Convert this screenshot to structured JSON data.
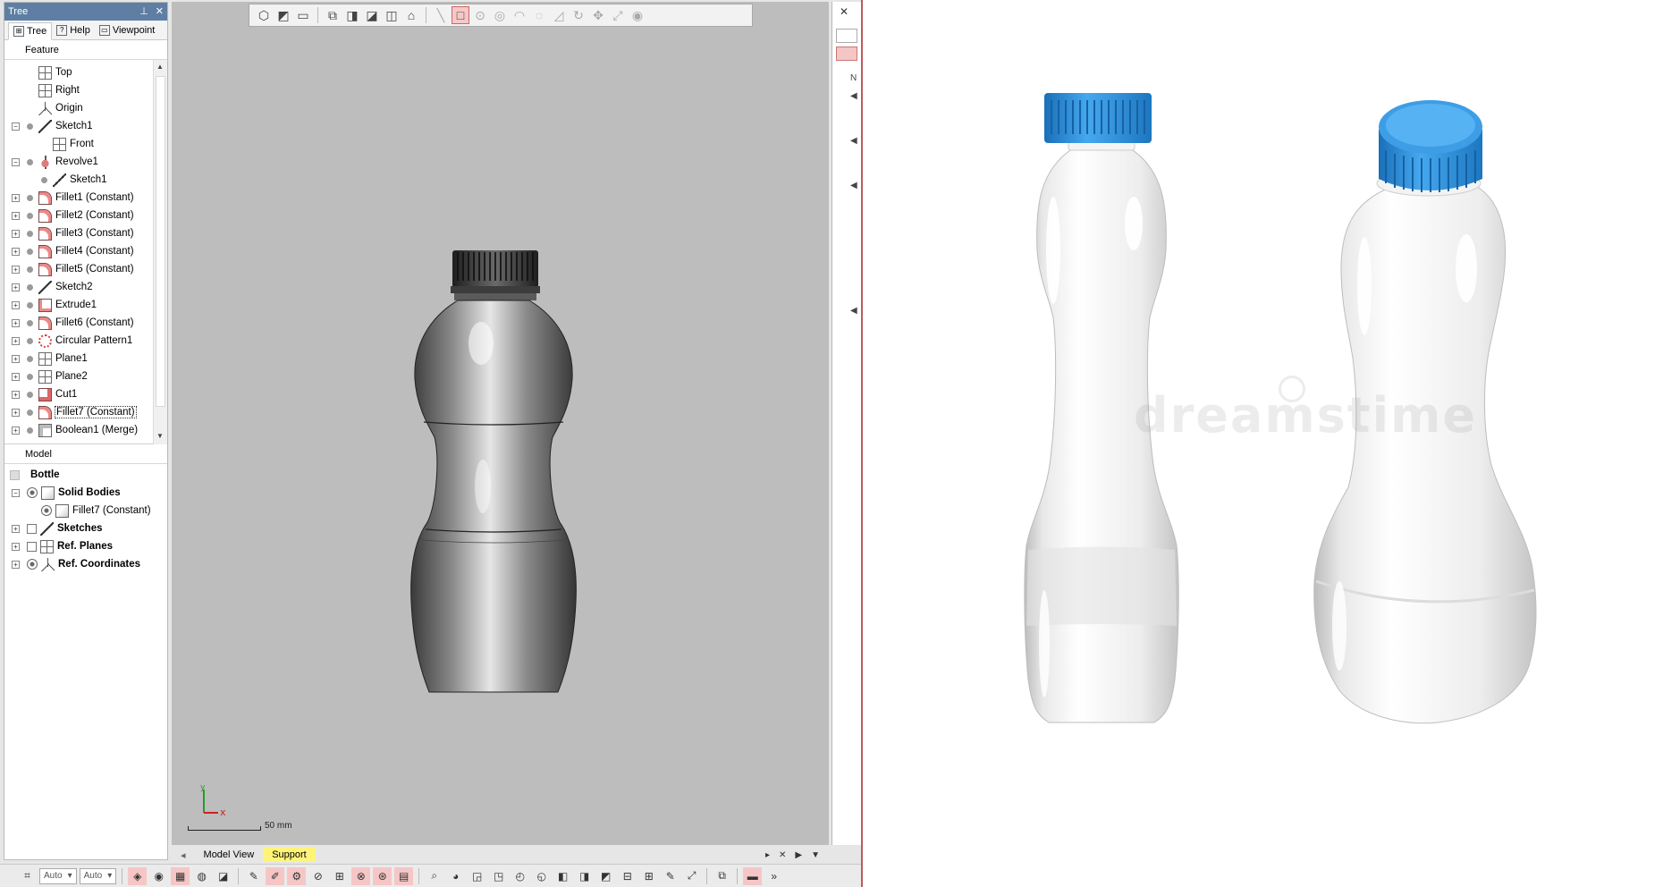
{
  "tree_panel": {
    "title": "Tree",
    "pin": "📌",
    "close": "✕",
    "tabs": [
      "Tree",
      "Help",
      "Viewpoint"
    ],
    "feature_header": "Feature",
    "model_header": "Model"
  },
  "features": [
    {
      "label": "Top",
      "icon": "plane-icon",
      "expander": "",
      "dot": false,
      "indent": 0
    },
    {
      "label": "Right",
      "icon": "plane-icon",
      "expander": "",
      "dot": false,
      "indent": 0
    },
    {
      "label": "Origin",
      "icon": "origin-icon",
      "expander": "",
      "dot": false,
      "indent": 0
    },
    {
      "label": "Sketch1",
      "icon": "sketch-icon",
      "expander": "−",
      "dot": true,
      "indent": 0
    },
    {
      "label": "Front",
      "icon": "plane-icon",
      "expander": "",
      "dot": false,
      "indent": 1
    },
    {
      "label": "Revolve1",
      "icon": "revolve-icon",
      "expander": "−",
      "dot": true,
      "indent": 0
    },
    {
      "label": "Sketch1",
      "icon": "sketch-icon",
      "expander": "",
      "dot": true,
      "indent": 1
    },
    {
      "label": "Fillet1 (Constant)",
      "icon": "fillet-icon",
      "expander": "+",
      "dot": true,
      "indent": 0
    },
    {
      "label": "Fillet2 (Constant)",
      "icon": "fillet-icon",
      "expander": "+",
      "dot": true,
      "indent": 0
    },
    {
      "label": "Fillet3 (Constant)",
      "icon": "fillet-icon",
      "expander": "+",
      "dot": true,
      "indent": 0
    },
    {
      "label": "Fillet4 (Constant)",
      "icon": "fillet-icon",
      "expander": "+",
      "dot": true,
      "indent": 0
    },
    {
      "label": "Fillet5 (Constant)",
      "icon": "fillet-icon",
      "expander": "+",
      "dot": true,
      "indent": 0
    },
    {
      "label": "Sketch2",
      "icon": "sketch-icon",
      "expander": "+",
      "dot": true,
      "indent": 0
    },
    {
      "label": "Extrude1",
      "icon": "extrude-icon",
      "expander": "+",
      "dot": true,
      "indent": 0
    },
    {
      "label": "Fillet6 (Constant)",
      "icon": "fillet-icon",
      "expander": "+",
      "dot": true,
      "indent": 0
    },
    {
      "label": "Circular Pattern1",
      "icon": "pattern-icon",
      "expander": "+",
      "dot": true,
      "indent": 0
    },
    {
      "label": "Plane1",
      "icon": "plane-icon",
      "expander": "+",
      "dot": true,
      "indent": 0
    },
    {
      "label": "Plane2",
      "icon": "plane-icon",
      "expander": "+",
      "dot": true,
      "indent": 0
    },
    {
      "label": "Cut1",
      "icon": "cut-icon",
      "expander": "+",
      "dot": true,
      "indent": 0
    },
    {
      "label": "Fillet7 (Constant)",
      "icon": "fillet-icon",
      "expander": "+",
      "dot": true,
      "indent": 0,
      "selected": true
    },
    {
      "label": "Boolean1 (Merge)",
      "icon": "boolean-icon",
      "expander": "+",
      "dot": true,
      "indent": 0
    }
  ],
  "model": {
    "root": "Bottle",
    "items": [
      {
        "label": "Solid Bodies",
        "bold": true,
        "expander": "−",
        "icon": "body-icon",
        "indent": 0
      },
      {
        "label": "Fillet7 (Constant)",
        "bold": false,
        "expander": "",
        "icon": "body-icon",
        "indent": 1
      },
      {
        "label": "Sketches",
        "bold": true,
        "expander": "+",
        "icon": "sketch-icon",
        "indent": 0
      },
      {
        "label": "Ref. Planes",
        "bold": true,
        "expander": "+",
        "icon": "plane-icon",
        "indent": 0
      },
      {
        "label": "Ref. Coordinates",
        "bold": true,
        "expander": "+",
        "icon": "origin-icon",
        "indent": 0
      }
    ]
  },
  "viewport": {
    "scale_label": "50 mm",
    "triad_x": "x",
    "triad_y": "y"
  },
  "view_tabs": [
    "Model View",
    "Support"
  ],
  "bottom_toolbar": {
    "select1": "Auto",
    "select2": "Auto"
  },
  "render": {
    "watermark": "dreamstime",
    "cap_color": "#2c8fd8",
    "bottle_color": "#f2f2f2"
  },
  "colors": {
    "tree_titlebar": "#5e7fa3",
    "viewport_bg": "#bdbdbd",
    "support_tab": "#fff47a",
    "highlight_btn": "#f6c8c8"
  }
}
